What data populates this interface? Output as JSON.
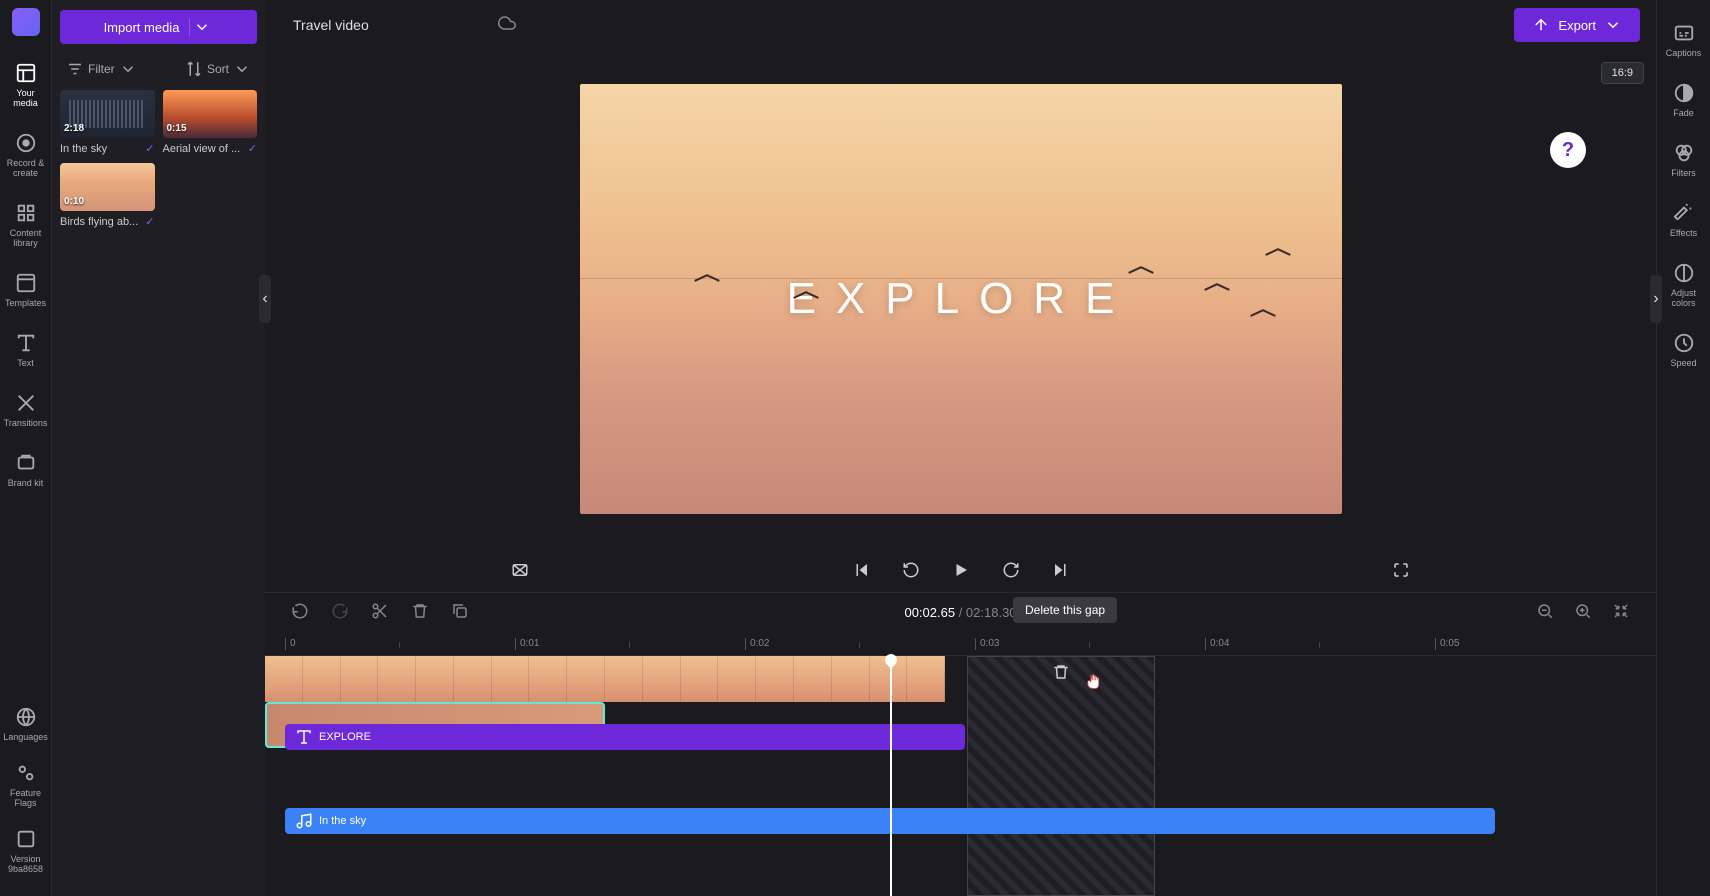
{
  "project": {
    "name": "Travel video"
  },
  "header": {
    "import_label": "Import media",
    "export_label": "Export",
    "aspect_ratio": "16:9"
  },
  "left_rail": {
    "items": [
      {
        "label": "Your media"
      },
      {
        "label": "Record & create"
      },
      {
        "label": "Content library"
      },
      {
        "label": "Templates"
      },
      {
        "label": "Text"
      },
      {
        "label": "Transitions"
      },
      {
        "label": "Brand kit"
      }
    ],
    "bottom": [
      {
        "label": "Languages"
      },
      {
        "label": "Feature Flags"
      },
      {
        "label_line1": "Version",
        "label_line2": "9ba8658"
      }
    ]
  },
  "media_panel": {
    "filter_label": "Filter",
    "sort_label": "Sort",
    "items": [
      {
        "duration": "2:18",
        "name": "In the sky",
        "kind": "audio"
      },
      {
        "duration": "0:15",
        "name": "Aerial view of ...",
        "kind": "mountain"
      },
      {
        "duration": "0:10",
        "name": "Birds flying ab...",
        "kind": "birds"
      }
    ]
  },
  "preview": {
    "overlay_text": "EXPLORE"
  },
  "playback": {
    "time_current": "00:02.65",
    "time_separator": " / ",
    "time_total": "02:18.30"
  },
  "timeline": {
    "tooltip": "Delete this gap",
    "ruler_marks": [
      "0",
      "0:01",
      "0:02",
      "0:03",
      "0:04",
      "0:05"
    ],
    "text_track_label": "EXPLORE",
    "audio_track_label": "In the sky"
  },
  "right_rail": {
    "items": [
      {
        "label": "Captions"
      },
      {
        "label": "Fade"
      },
      {
        "label": "Filters"
      },
      {
        "label": "Effects"
      },
      {
        "label": "Adjust colors"
      },
      {
        "label": "Speed"
      }
    ]
  }
}
